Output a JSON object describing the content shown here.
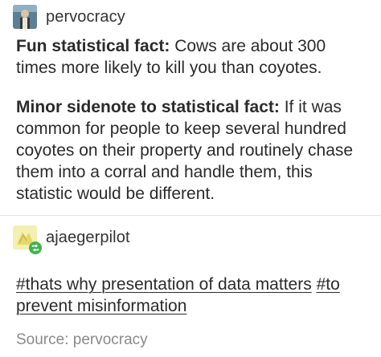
{
  "posts": [
    {
      "username": "pervocracy",
      "paragraphs": [
        {
          "bold": "Fun statistical fact:",
          "text": " Cows are about 300 times more likely to kill you than coyotes."
        },
        {
          "bold": "Minor sidenote to statistical fact:",
          "text": " If it was common for people to keep several hundred coyotes on their property and routinely chase them into a corral and handle them, this statistic would be different."
        }
      ]
    },
    {
      "username": "ajaegerpilot",
      "tags": [
        "#thats why presentation of data matters",
        "#to prevent misinformation"
      ],
      "source": "Source: pervocracy"
    }
  ],
  "icons": {
    "avatar1": "pervocracy-avatar-icon",
    "avatar2": "ajaegerpilot-avatar-icon",
    "reblog": "reblog-icon"
  },
  "colors": {
    "text": "#2b2b2b",
    "muted": "#8a8a8a",
    "reblog_badge": "#3fb34f",
    "divider": "#e3e3e3"
  }
}
